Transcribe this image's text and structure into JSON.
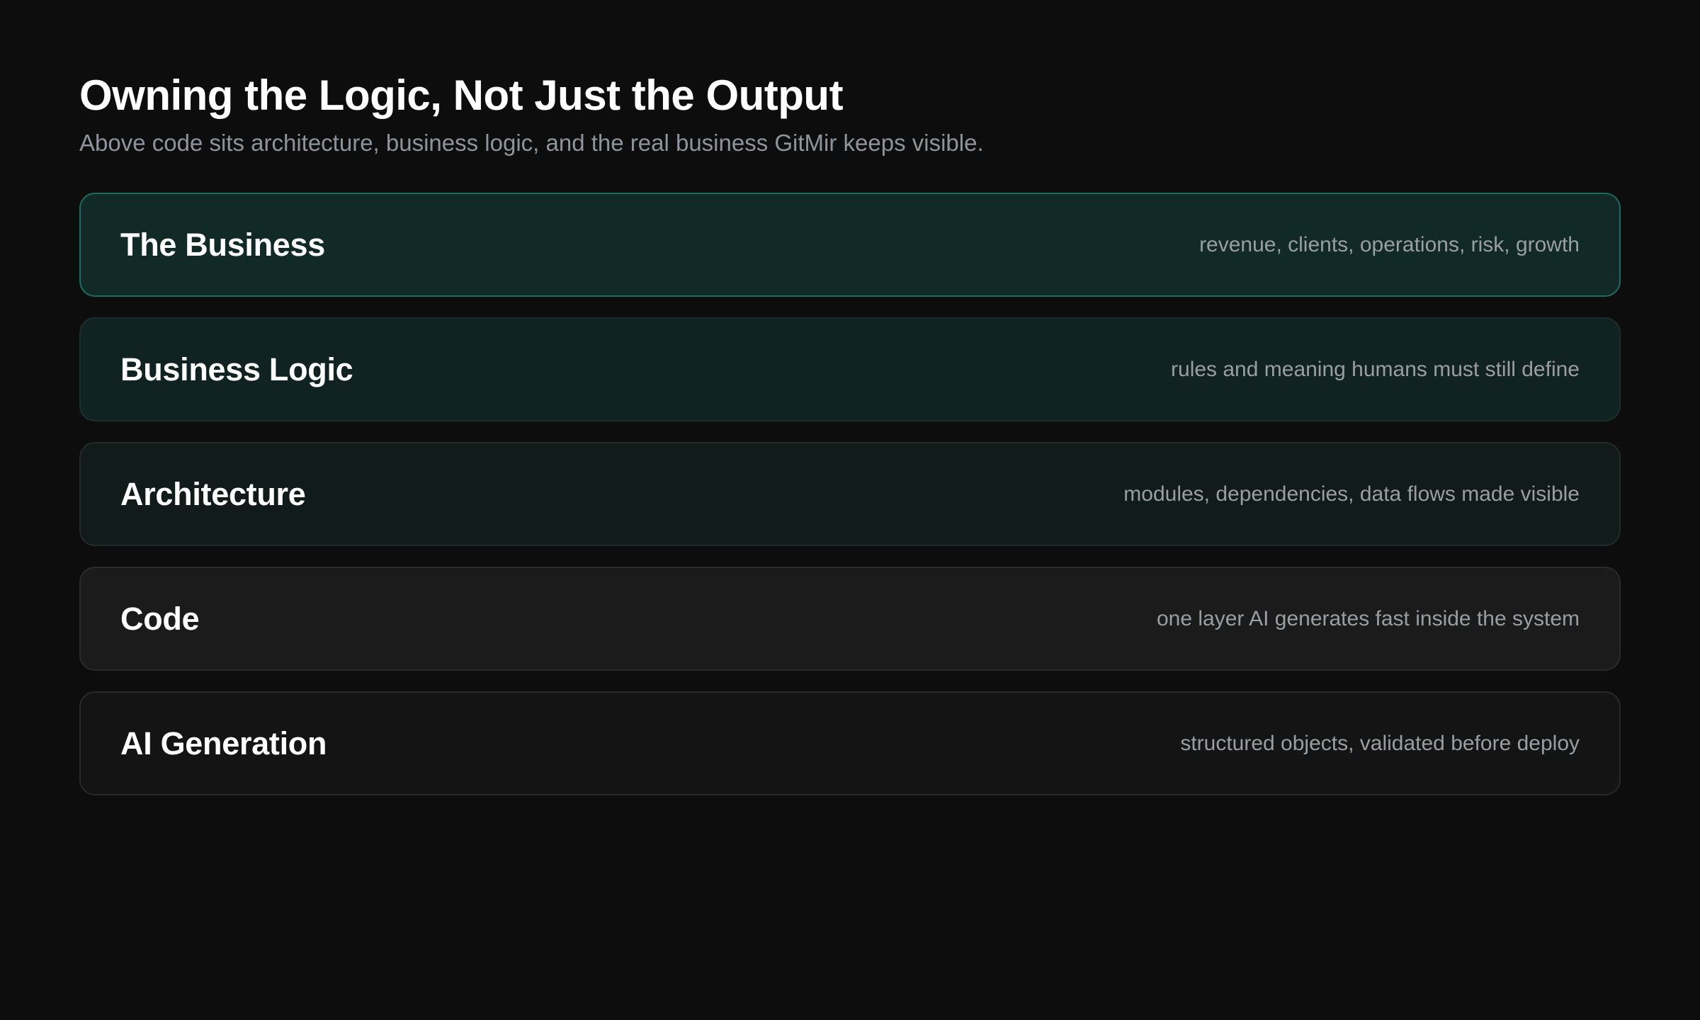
{
  "header": {
    "title": "Owning the Logic, Not Just the Output",
    "subtitle": "Above code sits architecture, business logic, and the real business GitMir keeps visible."
  },
  "layers": [
    {
      "name": "The Business",
      "description": "revenue, clients, operations, risk, growth",
      "background": "#112a28",
      "border": "#1d6b5f"
    },
    {
      "name": "Business Logic",
      "description": "rules and meaning humans must still define",
      "background": "#102222",
      "border": "#1d2e2d"
    },
    {
      "name": "Architecture",
      "description": "modules, dependencies, data flows made visible",
      "background": "#111b1a",
      "border": "#232a29"
    },
    {
      "name": "Code",
      "description": "one layer AI generates fast inside the system",
      "background": "#1b1b1b",
      "border": "#2a2a2a"
    },
    {
      "name": "AI Generation",
      "description": "structured objects, validated before deploy",
      "background": "#141414",
      "border": "#282828"
    }
  ]
}
